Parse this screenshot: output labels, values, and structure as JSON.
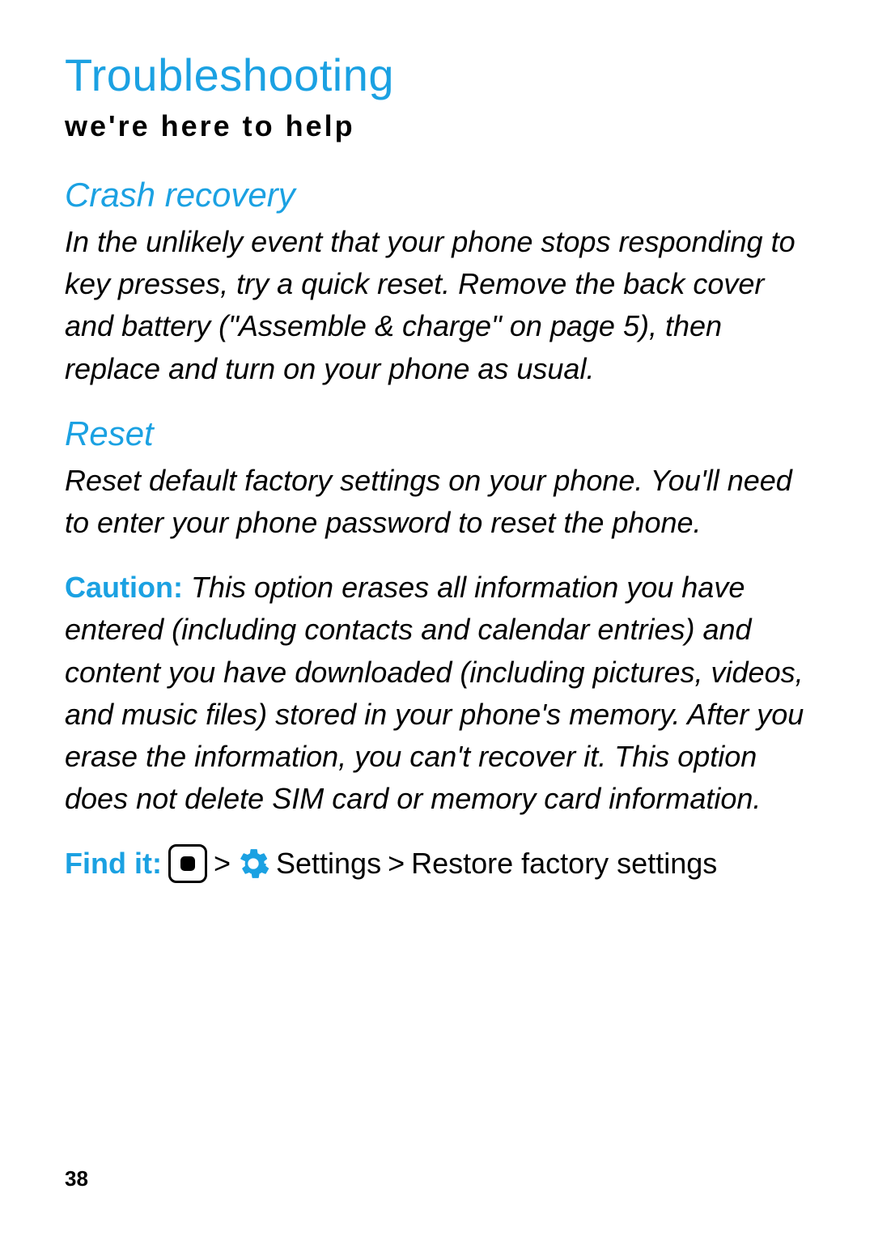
{
  "title": "Troubleshooting",
  "subtitle": "we're here to help",
  "section1": {
    "heading": "Crash recovery",
    "body": "In the unlikely event that your phone stops responding to key presses, try a quick reset. Remove the back cover and battery (\"Assemble & charge\" on page 5), then replace and turn on your phone as usual."
  },
  "section2": {
    "heading": "Reset",
    "body": "Reset default factory settings on your phone. You'll need to enter your phone password to reset the phone.",
    "caution_label": "Caution:",
    "caution_body": " This option erases all information you have entered (including contacts and calendar entries) and content you have downloaded (including pictures, videos, and music files) stored in your phone's memory. After you erase the information, you can't recover it. This option does not delete SIM card or memory card information."
  },
  "findit": {
    "label": "Find it:",
    "sep1": ">",
    "settings": "Settings",
    "sep2": ">",
    "restore": "Restore factory settings"
  },
  "page_number": "38"
}
